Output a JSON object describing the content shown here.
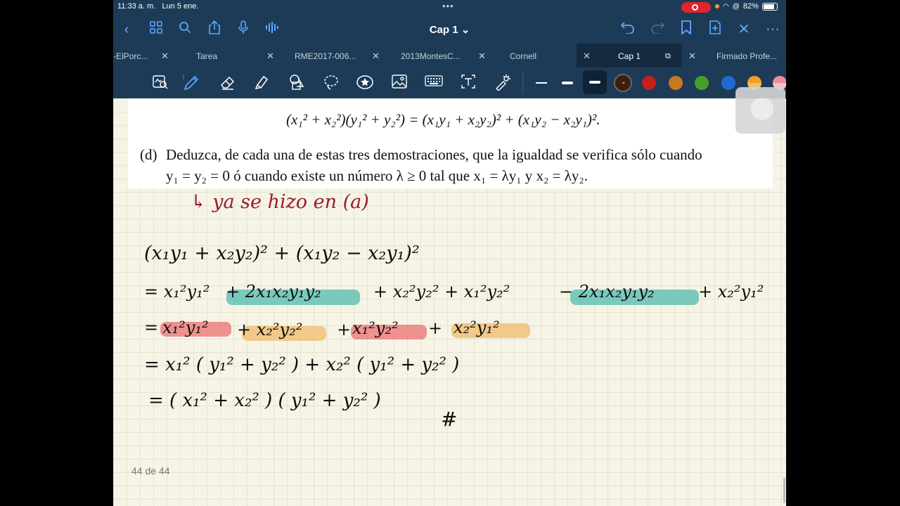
{
  "status": {
    "time": "11:33 a. m.",
    "date": "Lun 5 ene.",
    "battery": "82%"
  },
  "nav": {
    "title": "Cap 1 ⌄"
  },
  "tabs": [
    {
      "label": "-ElPorc...",
      "active": false
    },
    {
      "label": "Tarea",
      "active": false
    },
    {
      "label": "RME2017-006...",
      "active": false
    },
    {
      "label": "2013MontesC...",
      "active": false
    },
    {
      "label": "Cornell",
      "active": false
    },
    {
      "label": "Cap 1",
      "active": true
    },
    {
      "label": "Firmado Profe...",
      "active": false
    }
  ],
  "toolbar": {
    "colors": [
      "#3a1f10",
      "#c81e1e",
      "#c8781e",
      "#46a028",
      "#1e6ad2",
      "#f0a028",
      "#f08c96"
    ]
  },
  "document": {
    "equation": "(x₁² + x₂²)(y₁² + y₂²) = (x₁y₁ + x₂y₂)² + (x₁y₂ − x₂y₁)².",
    "item_label": "(d)",
    "item_line1": "Deduzca, de cada una de estas tres demostraciones, que la igualdad se verifica sólo cuando",
    "item_line2": "y₁ = y₂ = 0 ó cuando existe un número λ ≥ 0 tal que x₁ = λy₁ y x₂ = λy₂.",
    "page_indicator": "44 de 44"
  },
  "handwriting": {
    "note": "↳ ya se hizo en (a)",
    "line1": "(x₁y₁ + x₂y₂)² + (x₁y₂ − x₂y₁)²",
    "line2a": "= x₁²y₁²",
    "line2b": "+ 2x₁x₂y₁y₂",
    "line2c": "+ x₂²y₂² + x₁²y₂²",
    "line2d": "− 2x₁x₂y₁y₂",
    "line2e": "+ x₂²y₁²",
    "line3_eq": "=",
    "line3a": "x₁²y₁²",
    "line3b": "+ x₂²y₂²",
    "line3c": "+",
    "line3d": "x₁²y₂²",
    "line3e": "+",
    "line3f": "x₂²y₁²",
    "line4": "=  x₁² ( y₁² + y₂² )  +   x₂² ( y₁² + y₂² )",
    "line5": "= ( x₁² + x₂² ) ( y₁² + y₂² )",
    "end_mark": "#"
  }
}
